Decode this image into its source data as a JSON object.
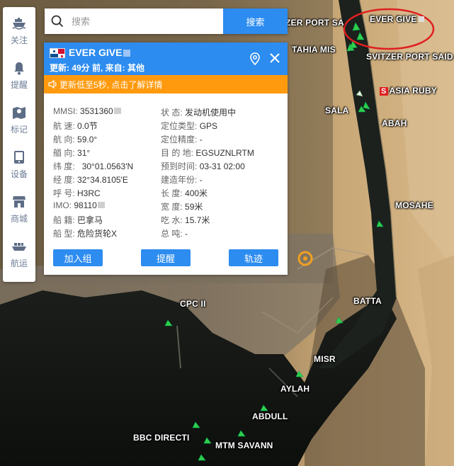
{
  "toolbar": {
    "items": [
      {
        "icon": "ship-icon",
        "label": "关注"
      },
      {
        "icon": "bell-icon",
        "label": "提醒"
      },
      {
        "icon": "map-pin-icon",
        "label": "标记"
      },
      {
        "icon": "device-icon",
        "label": "设备"
      },
      {
        "icon": "store-icon",
        "label": "商城"
      },
      {
        "icon": "cargo-ship-icon",
        "label": "航运"
      }
    ]
  },
  "search": {
    "placeholder": "搜索",
    "button_label": "搜索"
  },
  "panel": {
    "ship_name": "EVER GIVE",
    "update_text": "更新: 49分 前, 来自: 其他",
    "notice": "更新低至5秒, 点击了解详情",
    "left_fields": [
      {
        "label": "MMSI:",
        "value": "3531360"
      },
      {
        "label": "航 速:",
        "value": "0.0节"
      },
      {
        "label": "航 向:",
        "value": "59.0°"
      },
      {
        "label": "艏 向:",
        "value": "31°"
      },
      {
        "label": "纬 度:",
        "value": "30°01.0563'N"
      },
      {
        "label": "经 度:",
        "value": "32°34.8105'E"
      },
      {
        "label": "呼 号:",
        "value": "H3RC"
      },
      {
        "label": "IMO:",
        "value": "98110"
      },
      {
        "label": "船 籍:",
        "value": "巴拿马"
      },
      {
        "label": "船 型:",
        "value": "危险货轮X"
      }
    ],
    "right_fields": [
      {
        "label": "状    态:",
        "value": "发动机使用中"
      },
      {
        "label": "定位类型:",
        "value": "GPS"
      },
      {
        "label": "定位精度:",
        "value": "-"
      },
      {
        "label": "目 的 地:",
        "value": "EGSUZNLRTM"
      },
      {
        "label": "预到时间:",
        "value": "03-31 02:00"
      },
      {
        "label": "建造年份:",
        "value": "-"
      },
      {
        "label": "长    度:",
        "value": "400米"
      },
      {
        "label": "宽    度:",
        "value": "59米"
      },
      {
        "label": "吃    水:",
        "value": "15.7米"
      },
      {
        "label": "总    吨:",
        "value": "-"
      }
    ],
    "buttons": {
      "add_group": "加入组",
      "remind": "提醒",
      "track": "轨迹"
    }
  },
  "map_labels": {
    "port_sa": "ZER PORT SA",
    "ever_give": "EVER GIVE",
    "tahia": "TAHIA MIS",
    "svitzer": "SVITZER PORT SAID",
    "asia_ruby_badge": "S",
    "asia_ruby": "ASIA RUBY",
    "salam": "SALA",
    "abah": "ABAH",
    "mosahe": "MOSAHE",
    "cpc": "CPC II",
    "batta": "BATTA",
    "misr": "MISR",
    "aylah": "AYLAH",
    "abdull": "ABDULL",
    "bbc": "BBC DIRECTI",
    "mtm": "MTM SAVANN"
  },
  "colors": {
    "primary": "#2d8cf0",
    "notice": "#ff9a0e",
    "highlight_circle": "#e02020",
    "ship_marker": "#2fcf4a"
  }
}
